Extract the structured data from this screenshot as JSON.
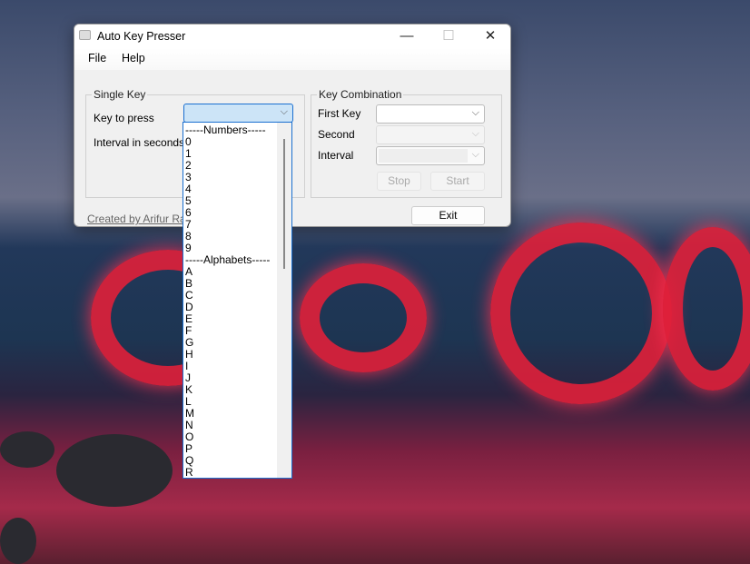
{
  "window": {
    "title": "Auto Key Presser",
    "minimize": "—",
    "maximize": "☐",
    "close": "✕"
  },
  "menu": [
    "File",
    "Help"
  ],
  "single_key": {
    "legend": "Single Key",
    "key_label": "Key to press",
    "interval_label": "Interval in seconds",
    "key_value": ""
  },
  "key_combination": {
    "legend": "Key Combination",
    "first_label": "First Key",
    "second_label": "Second",
    "interval_label": "Interval",
    "stop": "Stop",
    "start": "Start"
  },
  "exit": "Exit",
  "credit": "Created by Arifur Rahm",
  "dropdown_items": [
    "-----Numbers-----",
    "0",
    "1",
    "2",
    "3",
    "4",
    "5",
    "6",
    "7",
    "8",
    "9",
    "-----Alphabets-----",
    "A",
    "B",
    "C",
    "D",
    "E",
    "F",
    "G",
    "H",
    "I",
    "J",
    "K",
    "L",
    "M",
    "N",
    "O",
    "P",
    "Q",
    "R"
  ],
  "chevron": "⌵"
}
